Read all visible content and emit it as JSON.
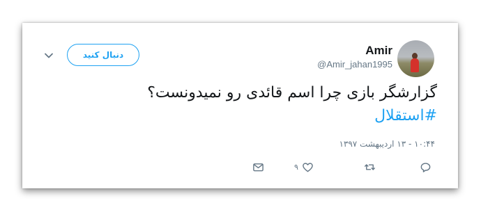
{
  "tweet": {
    "author_name": "Amir",
    "author_handle": "@Amir_jahan1995",
    "follow_label": "دنبال کنید",
    "text": "گزارشگر بازی چرا اسم قائدی رو نمیدونست؟",
    "hashtag": "#استقلال",
    "timestamp": "۱۰:۴۴ - ۱۳ اردیبهشت ۱۳۹۷",
    "like_count": "۹"
  },
  "icons": {
    "menu": "chevron-down-icon",
    "reply": "reply-icon",
    "retweet": "retweet-icon",
    "like": "heart-icon",
    "dm": "envelope-icon"
  },
  "colors": {
    "accent": "#1da1f2",
    "secondary_text": "#657786",
    "primary_text": "#14171a"
  }
}
